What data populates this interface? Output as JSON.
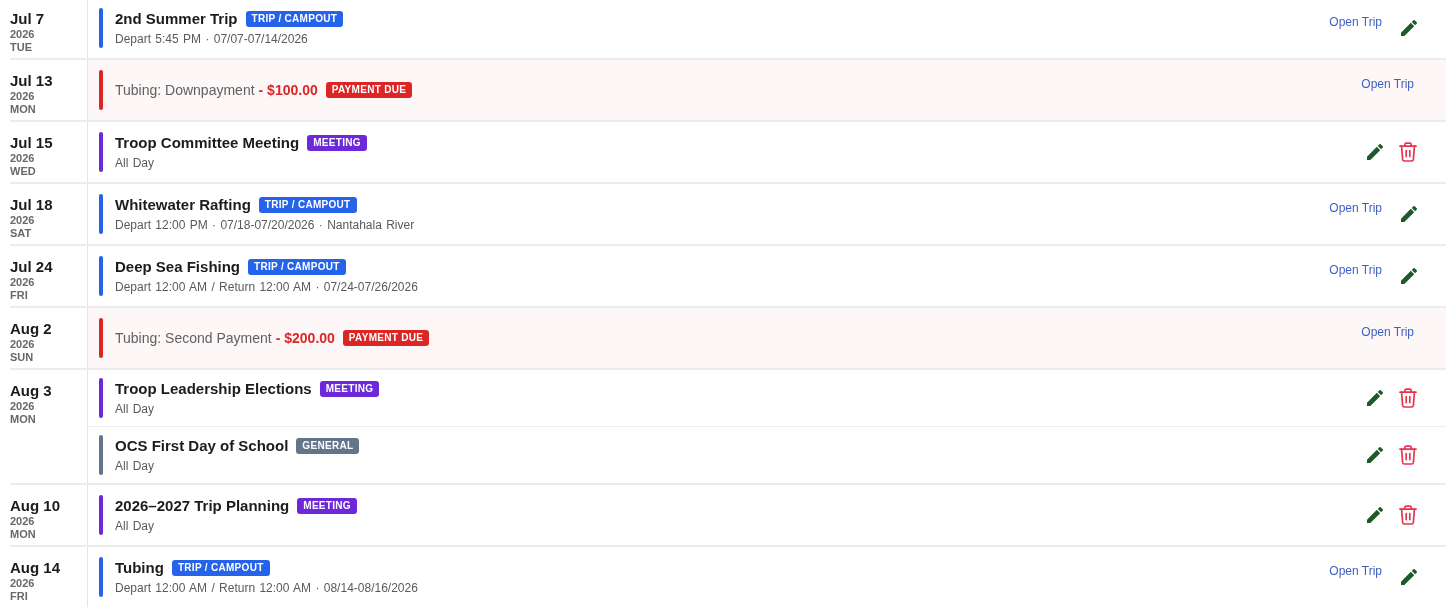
{
  "days": [
    {
      "date": "Jul 7",
      "year": "2026",
      "weekday": "TUE",
      "events": [
        {
          "kind": "event",
          "title": "2nd Summer Trip",
          "tag": "TRIP / CAMPOUT",
          "color": "#2563eb",
          "details": "Depart 5:45 PM · 07/07-07/14/2026",
          "link": "Open Trip",
          "edit": true,
          "delete": false
        }
      ]
    },
    {
      "date": "Jul 13",
      "year": "2026",
      "weekday": "MON",
      "events": [
        {
          "kind": "payment",
          "title": "Tubing: Downpayment",
          "amount": "- $100.00",
          "tag": "PAYMENT DUE",
          "color": "#dc2626",
          "link": "Open Trip",
          "edit": false,
          "delete": false
        }
      ]
    },
    {
      "date": "Jul 15",
      "year": "2026",
      "weekday": "WED",
      "events": [
        {
          "kind": "event",
          "title": "Troop Committee Meeting",
          "tag": "MEETING",
          "color": "#6d28d9",
          "details": "All Day",
          "edit": true,
          "delete": true
        }
      ]
    },
    {
      "date": "Jul 18",
      "year": "2026",
      "weekday": "SAT",
      "events": [
        {
          "kind": "event",
          "title": "Whitewater Rafting",
          "tag": "TRIP / CAMPOUT",
          "color": "#2563eb",
          "details": "Depart 12:00 PM · 07/18-07/20/2026 · Nantahala River",
          "link": "Open Trip",
          "edit": true,
          "delete": false
        }
      ]
    },
    {
      "date": "Jul 24",
      "year": "2026",
      "weekday": "FRI",
      "events": [
        {
          "kind": "event",
          "title": "Deep Sea Fishing",
          "tag": "TRIP / CAMPOUT",
          "color": "#2563eb",
          "details": "Depart 12:00 AM / Return 12:00 AM · 07/24-07/26/2026",
          "link": "Open Trip",
          "edit": true,
          "delete": false
        }
      ]
    },
    {
      "date": "Aug 2",
      "year": "2026",
      "weekday": "SUN",
      "events": [
        {
          "kind": "payment",
          "title": "Tubing: Second Payment",
          "amount": "- $200.00",
          "tag": "PAYMENT DUE",
          "color": "#dc2626",
          "link": "Open Trip",
          "edit": false,
          "delete": false
        }
      ]
    },
    {
      "date": "Aug 3",
      "year": "2026",
      "weekday": "MON",
      "events": [
        {
          "kind": "event",
          "title": "Troop Leadership Elections",
          "tag": "MEETING",
          "color": "#6d28d9",
          "details": "All Day",
          "edit": true,
          "delete": true
        },
        {
          "kind": "event",
          "title": "OCS First Day of School",
          "tag": "GENERAL",
          "color": "#64748b",
          "details": "All Day",
          "edit": true,
          "delete": true
        }
      ]
    },
    {
      "date": "Aug 10",
      "year": "2026",
      "weekday": "MON",
      "events": [
        {
          "kind": "event",
          "title": "2026–2027 Trip Planning",
          "tag": "MEETING",
          "color": "#6d28d9",
          "details": "All Day",
          "edit": true,
          "delete": true
        }
      ]
    },
    {
      "date": "Aug 14",
      "year": "2026",
      "weekday": "FRI",
      "events": [
        {
          "kind": "event",
          "title": "Tubing",
          "tag": "TRIP / CAMPOUT",
          "color": "#2563eb",
          "details": "Depart 12:00 AM / Return 12:00 AM · 08/14-08/16/2026",
          "link": "Open Trip",
          "edit": true,
          "delete": false
        }
      ]
    }
  ]
}
